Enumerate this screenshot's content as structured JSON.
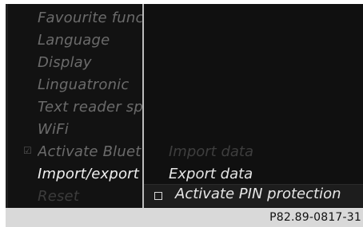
{
  "menu": {
    "items": [
      {
        "label": "Favourite func",
        "state": "inactive"
      },
      {
        "label": "Language",
        "state": "inactive"
      },
      {
        "label": "Display",
        "state": "inactive"
      },
      {
        "label": "Linguatronic",
        "state": "inactive"
      },
      {
        "label": "Text reader sp",
        "state": "inactive"
      },
      {
        "label": "WiFi",
        "state": "inactive"
      },
      {
        "label": "Activate Bluet",
        "state": "inactive",
        "icon": "checkbox-checked-icon"
      },
      {
        "label": "Import/export",
        "state": "active"
      },
      {
        "label": "Reset",
        "state": "dim"
      }
    ]
  },
  "submenu": {
    "items": [
      {
        "label": "Import data",
        "state": "disabled"
      },
      {
        "label": "Export data",
        "state": "enabled"
      },
      {
        "label": "Activate PIN protection",
        "state": "selected",
        "icon": "checkbox-icon"
      }
    ]
  },
  "footer": {
    "code": "P82.89-0817-31"
  },
  "colors": {
    "background": "#0b0b0b",
    "divider": "#bcbcbc",
    "active_text": "#f0f0f0",
    "inactive_text": "#6b6b6b",
    "footer": "#d9d9d9"
  }
}
